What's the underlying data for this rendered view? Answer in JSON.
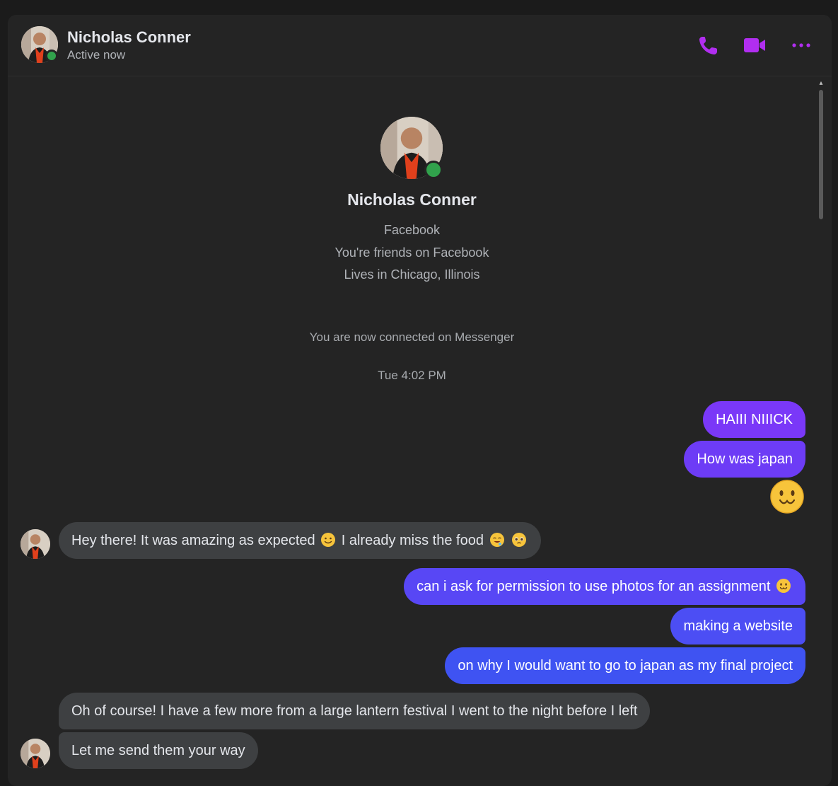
{
  "contact": {
    "name": "Nicholas Conner",
    "status": "Active now"
  },
  "header_icons": [
    "phone-icon",
    "video-camera-icon",
    "more-options-icon"
  ],
  "profile": {
    "name": "Nicholas Conner",
    "lines": [
      "Facebook",
      "You're friends on Facebook",
      "Lives in Chicago, Illinois"
    ]
  },
  "system": {
    "connected": "You are now connected on Messenger",
    "timestamp": "Tue 4:02 PM"
  },
  "messages": [
    {
      "from": "me",
      "text": "HAIII NIIICK"
    },
    {
      "from": "me",
      "text": "How was japan"
    },
    {
      "from": "me",
      "emoji": "smiling-face-emoji"
    },
    {
      "from": "them",
      "text1": "Hey there! It was amazing as expected",
      "text2": "I already miss the food",
      "emojis": [
        "slightly-smiling-emoji",
        "drooling-emoji",
        "pleading-emoji"
      ]
    },
    {
      "from": "me",
      "text": "can i ask for permission to use photos for an assignment",
      "emoji": "pleading-smile-emoji"
    },
    {
      "from": "me",
      "text": "making a website"
    },
    {
      "from": "me",
      "text": "on why I would want to go to japan as my final project"
    },
    {
      "from": "them",
      "text": "Oh of course! I have a few more from a large lantern festival I went to the night before I left"
    },
    {
      "from": "them",
      "text": "Let me send them your way"
    }
  ],
  "colors": {
    "accent": "#b12ef0",
    "bubble_gradient_top": "#7a38f8",
    "bubble_gradient_mid": "#5b47f4",
    "bubble_gradient_bottom": "#3a55f0",
    "incoming_bubble": "#3e4042",
    "online": "#31a24c"
  }
}
